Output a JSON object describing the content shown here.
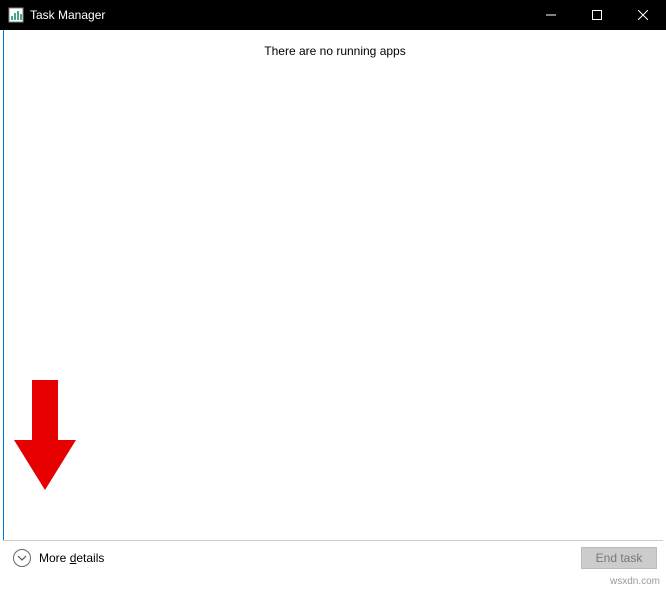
{
  "titlebar": {
    "title": "Task Manager"
  },
  "content": {
    "empty_message": "There are no running apps"
  },
  "footer": {
    "more_details_label": "More details",
    "end_task_label": "End task"
  },
  "watermark": "wsxdn.com"
}
